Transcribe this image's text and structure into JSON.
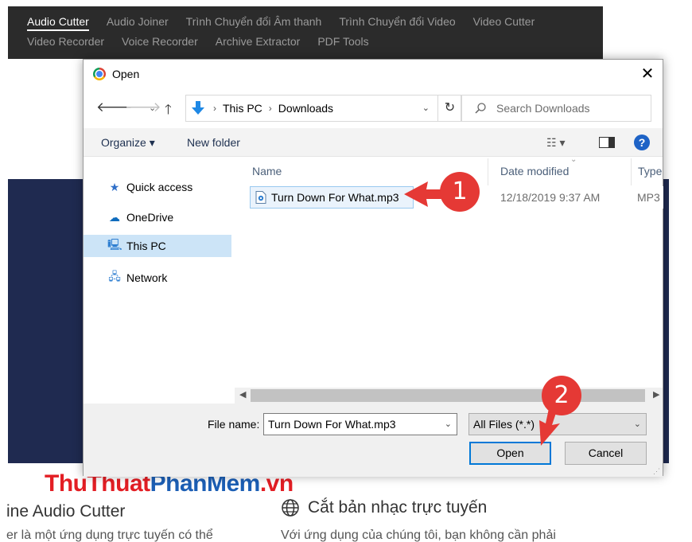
{
  "site_nav": {
    "row1": [
      "Audio Cutter",
      "Audio Joiner",
      "Trình Chuyển đổi Âm thanh",
      "Trình Chuyển đổi Video",
      "Video Cutter"
    ],
    "row2": [
      "Video Recorder",
      "Voice Recorder",
      "Archive Extractor",
      "PDF Tools"
    ]
  },
  "dialog": {
    "title": "Open",
    "close_glyph": "✕",
    "breadcrumb": [
      "This PC",
      "Downloads"
    ],
    "search_placeholder": "Search Downloads",
    "toolbar": {
      "organize": "Organize ▾",
      "new_folder": "New folder",
      "help": "?"
    },
    "nav_items": [
      {
        "label": "Quick access",
        "icon": "star-icon",
        "glyph": "★",
        "selected": false
      },
      {
        "label": "OneDrive",
        "icon": "cloud-icon",
        "glyph": "☁",
        "selected": false
      },
      {
        "label": "This PC",
        "icon": "computer-icon",
        "glyph": "🖳",
        "selected": true
      },
      {
        "label": "Network",
        "icon": "network-icon",
        "glyph": "🖧",
        "selected": false
      }
    ],
    "columns": {
      "name": "Name",
      "date": "Date modified",
      "type": "Type"
    },
    "files": [
      {
        "name": "Turn Down For What.mp3",
        "date": "12/18/2019 9:37 AM",
        "type": "MP3"
      }
    ],
    "file_name_label": "File name:",
    "file_name_value": "Turn Down For What.mp3",
    "file_type_value": "All Files (*.*)",
    "open_label": "Open",
    "cancel_label": "Cancel"
  },
  "callouts": [
    "1",
    "2"
  ],
  "watermark": {
    "part1": "ThuThuat",
    "part2": "PhanMem",
    "part3": ".vn"
  },
  "page_below": {
    "left_heading": "ine Audio Cutter",
    "left_text": "er là một ứng dụng trực tuyến có thể",
    "right_heading": "Cắt bản nhạc trực tuyến",
    "right_text": "Với ứng dụng của chúng tôi, bạn không cần phải"
  },
  "colors": {
    "accent": "#0078d7",
    "selection": "#cce4f7",
    "callout": "#e53935",
    "site_bg": "#1f2a50"
  }
}
